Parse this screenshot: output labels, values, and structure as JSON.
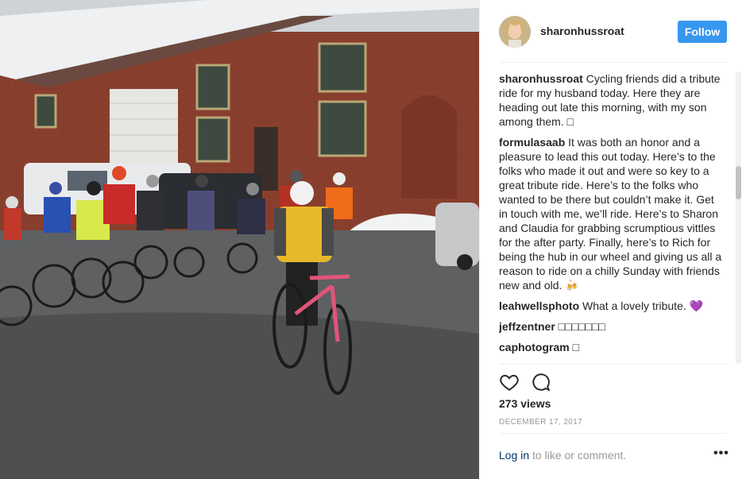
{
  "post": {
    "username": "sharonhussroat",
    "follow_label": "Follow",
    "views": "273 views",
    "date": "DECEMBER 17, 2017",
    "login_link": "Log in",
    "login_rest": " to like or comment.",
    "more_label": "•••"
  },
  "comments": [
    {
      "user": "sharonhussroat",
      "text": " Cycling friends did a tribute ride for my husband today. Here they are heading out late this morning, with my son among them. □"
    },
    {
      "user": "formulasaab",
      "text": " It was both an honor and a pleasure to lead this out today. Here’s to the folks who made it out and were so key to a great tribute ride. Here’s to the folks who wanted to be there but couldn’t make it. Get in touch with me, we’ll ride. Here’s to Sharon and Claudia for grabbing scrumptious vittles for the after party. Finally, here’s to Rich for being the hub in our wheel and giving us all a reason to ride on a chilly Sunday with friends new and old. 🍻"
    },
    {
      "user": "leahwellsphoto",
      "text": " What a lovely tribute. 💜"
    },
    {
      "user": "jeffzentner",
      "text": " □□□□□□□"
    },
    {
      "user": "caphotogram",
      "text": " □"
    }
  ],
  "icons": {
    "like": "heart-icon",
    "comment": "comment-icon",
    "more": "more-options-icon"
  },
  "colors": {
    "follow_bg": "#3897f0",
    "login_link": "#003569",
    "muted": "#999999"
  }
}
